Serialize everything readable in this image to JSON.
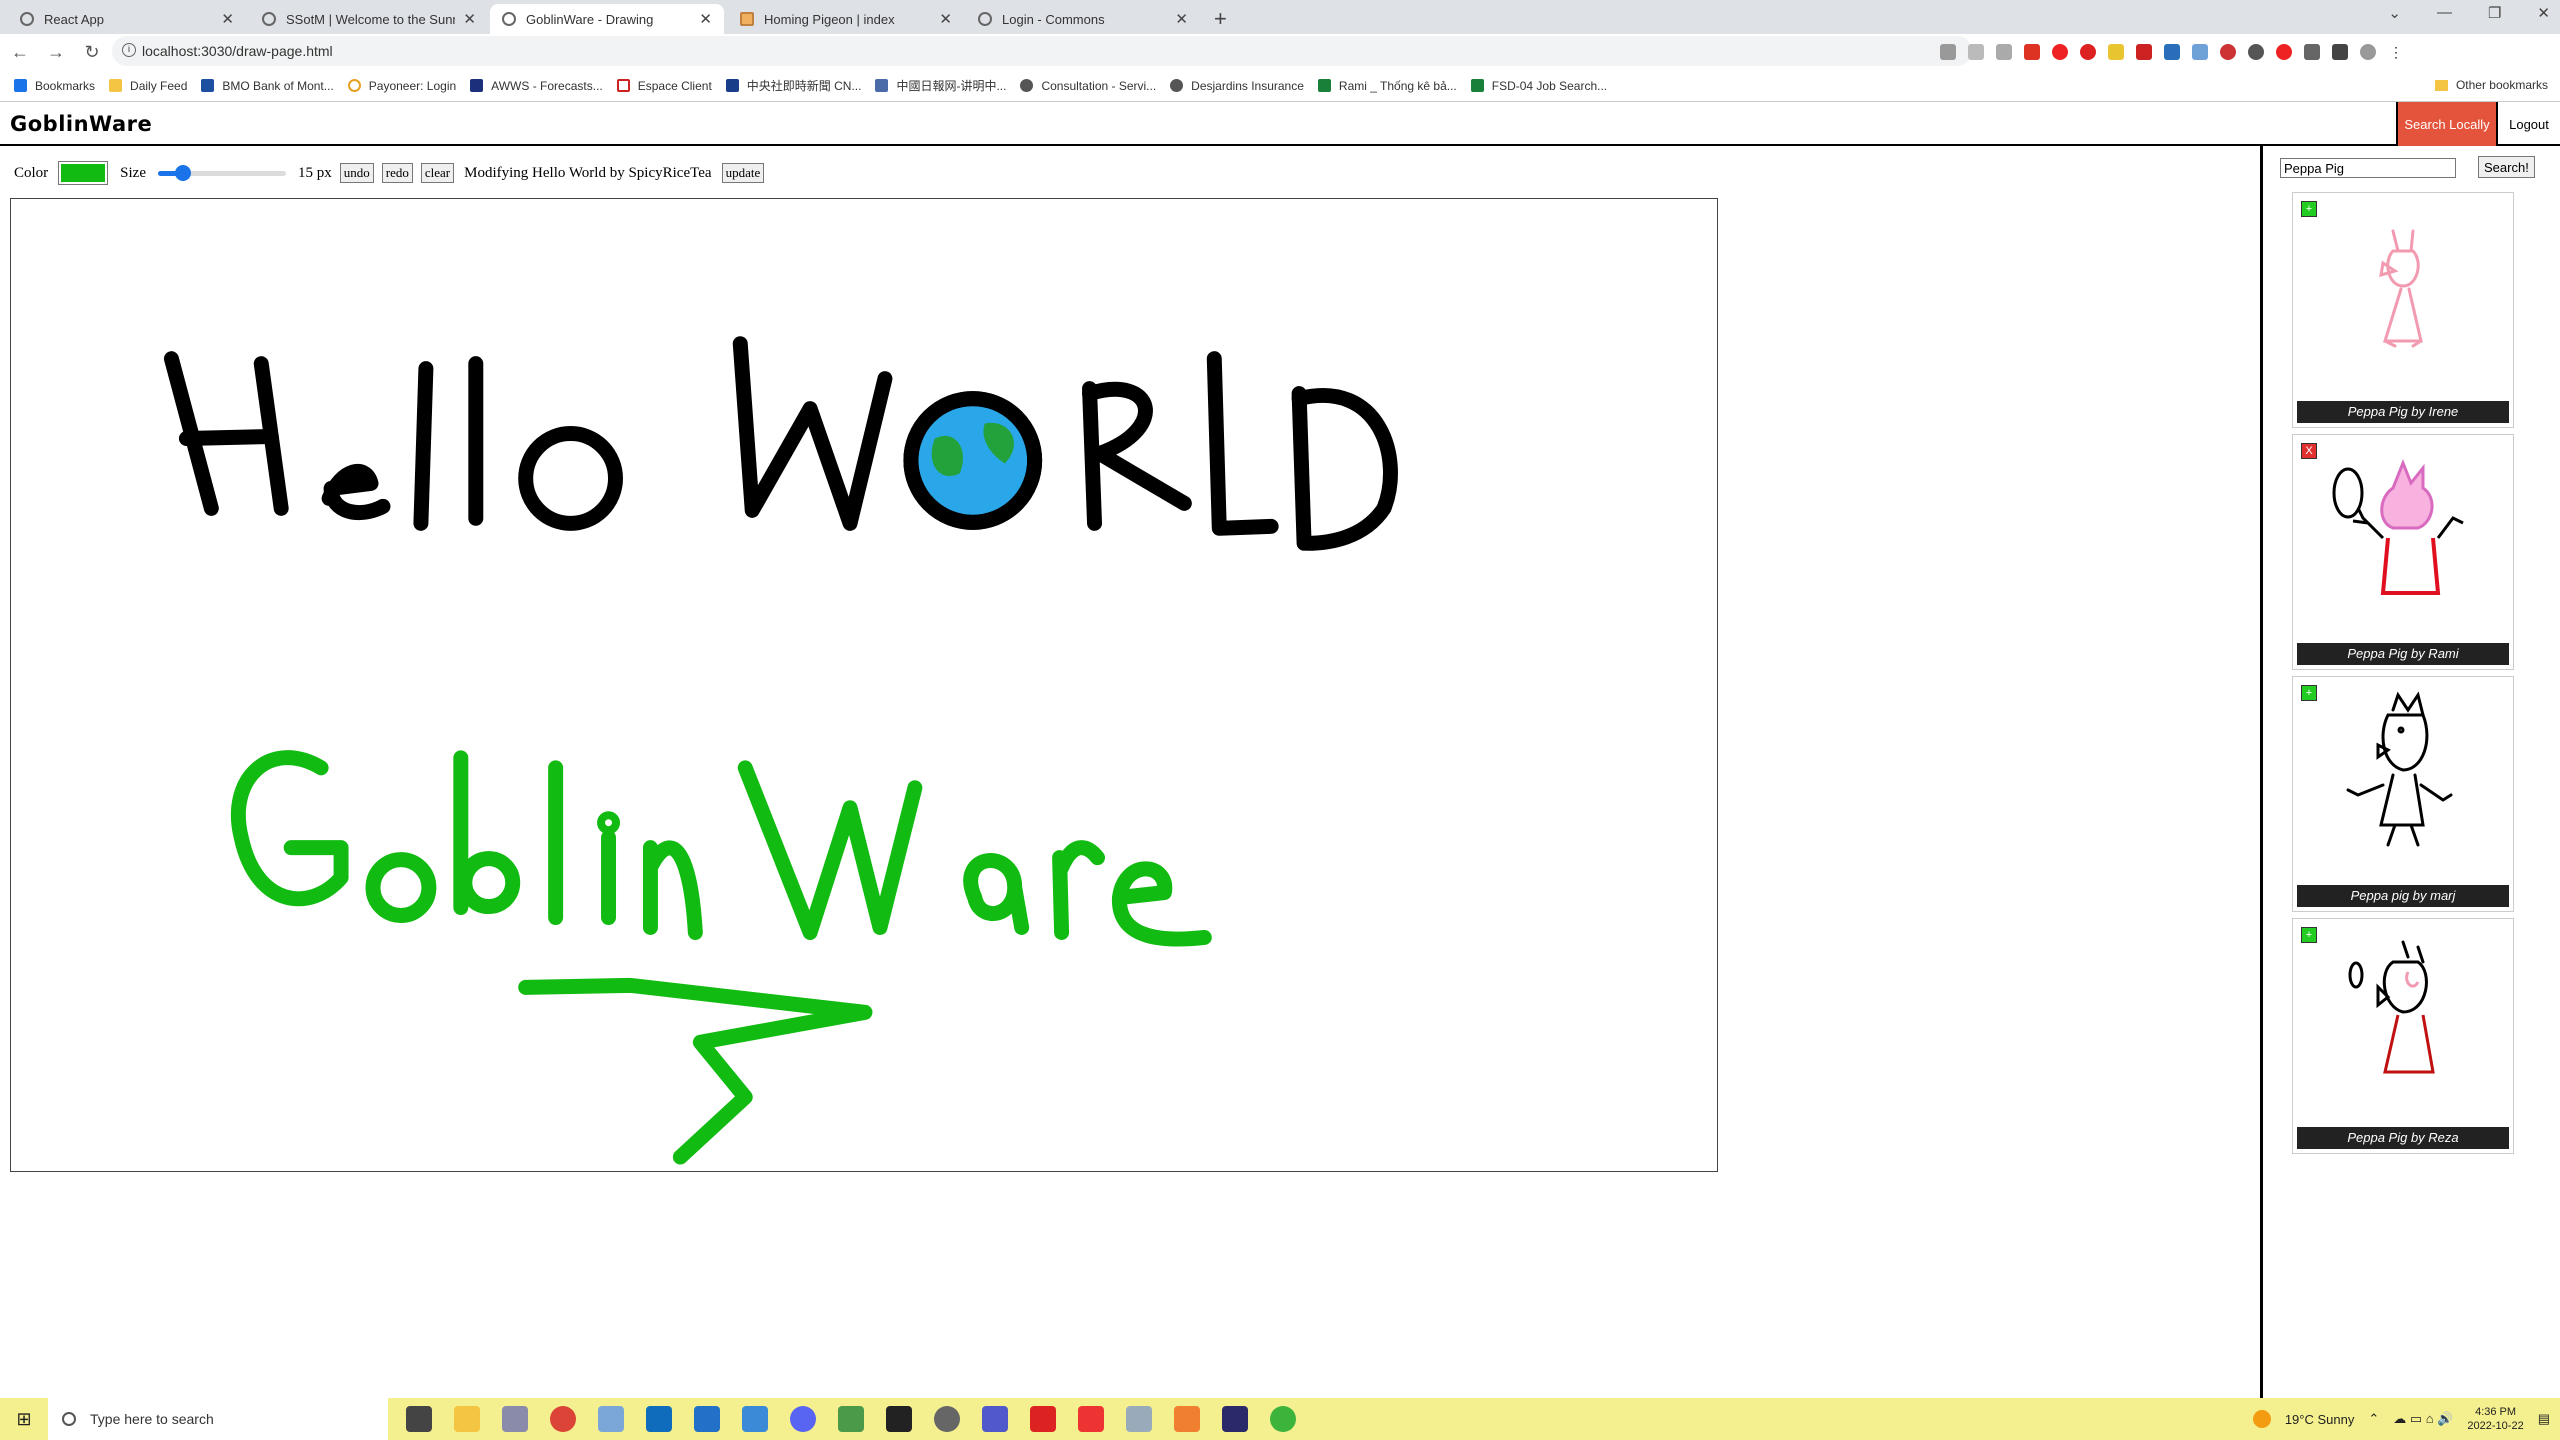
{
  "browser": {
    "tabs": [
      {
        "title": "React App",
        "active": false
      },
      {
        "title": "SSotM | Welcome to the Sunny S",
        "active": false
      },
      {
        "title": "GoblinWare - Drawing",
        "active": true
      },
      {
        "title": "Homing Pigeon | index",
        "active": false
      },
      {
        "title": "Login - Commons",
        "active": false
      }
    ],
    "url": "localhost:3030/draw-page.html",
    "bookmarks": [
      "Bookmarks",
      "Daily Feed",
      "BMO Bank of Mont...",
      "Payoneer: Login",
      "AWWS - Forecasts...",
      "Espace Client",
      "中央社即時新聞 CN...",
      "中國日報网-讲明中...",
      "Consultation - Servi...",
      "Desjardins Insurance",
      "Rami _ Thống kê bả...",
      "FSD-04 Job Search..."
    ],
    "other_bookmarks": "Other bookmarks"
  },
  "app": {
    "brand": "GoblinWare",
    "search_locally": "Search Locally",
    "logout": "Logout"
  },
  "toolbar": {
    "color_label": "Color",
    "color_value": "#11bb11",
    "size_label": "Size",
    "size_value": 15,
    "size_text": "15 px",
    "size_fraction": 0.15,
    "undo": "undo",
    "redo": "redo",
    "clear": "clear",
    "modifying": "Modifying Hello World by SpicyRiceTea",
    "update": "update"
  },
  "canvas": {
    "text_line1": "Hello WORLD",
    "text_line2": "GoblinWare"
  },
  "sidebar": {
    "search_value": "Peppa Pig",
    "search_button": "Search!",
    "cards": [
      {
        "caption": "Peppa Pig by Irene",
        "badge": "+"
      },
      {
        "caption": "Peppa Pig by Rami",
        "badge": "X"
      },
      {
        "caption": "Peppa pig by marj",
        "badge": "+"
      },
      {
        "caption": "Peppa Pig by Reza",
        "badge": "+"
      }
    ]
  },
  "taskbar": {
    "search_placeholder": "Type here to search",
    "weather": "19°C  Sunny",
    "time": "4:36 PM",
    "date": "2022-10-22"
  }
}
